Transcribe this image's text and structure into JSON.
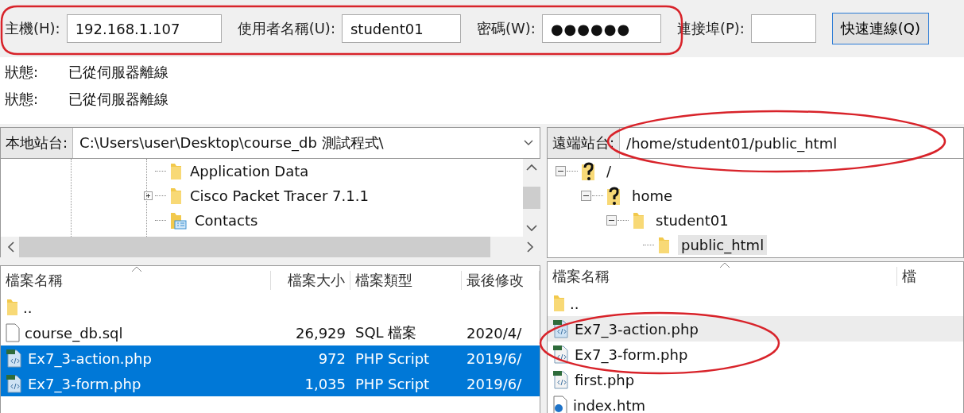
{
  "quickconnect": {
    "host_label": "主機(H):",
    "host": "192.168.1.107",
    "user_label": "使用者名稱(U):",
    "user": "student01",
    "password_label": "密碼(W):",
    "password": "●●●●●●",
    "port_label": "連接埠(P):",
    "connect_button": "快速連線(Q)"
  },
  "status_log": [
    {
      "label": "狀態:",
      "message": "已從伺服器離線"
    },
    {
      "label": "狀態:",
      "message": "已從伺服器離線"
    }
  ],
  "local_site": {
    "label": "本地站台:",
    "path": "C:\\Users\\user\\Desktop\\course_db 測試程式\\"
  },
  "local_tree": [
    {
      "name": "Application Data",
      "kind": "folder",
      "has_children": false
    },
    {
      "name": "Cisco Packet Tracer 7.1.1",
      "kind": "folder",
      "has_children": true
    },
    {
      "name": "Contacts",
      "kind": "contacts",
      "has_children": false
    }
  ],
  "remote_site": {
    "label": "遠端站台:",
    "path": "/home/student01/public_html"
  },
  "remote_tree": [
    {
      "name": "/",
      "kind": "unknown",
      "expanded": true,
      "selected": false,
      "children": [
        {
          "name": "home",
          "kind": "unknown",
          "expanded": true,
          "selected": false,
          "children": [
            {
              "name": "student01",
              "kind": "folder",
              "expanded": true,
              "selected": false,
              "children": [
                {
                  "name": "public_html",
                  "kind": "folder",
                  "selected": true
                }
              ]
            }
          ]
        }
      ]
    }
  ],
  "local_files": {
    "columns": [
      "檔案名稱",
      "檔案大小",
      "檔案類型",
      "最後修改"
    ],
    "rows": [
      {
        "name": "..",
        "kind": "folder",
        "size": "",
        "type": "",
        "modified": "",
        "selected": false
      },
      {
        "name": "course_db.sql",
        "kind": "file",
        "size": "26,929",
        "type": "SQL 檔案",
        "modified": "2020/4/",
        "selected": false
      },
      {
        "name": "Ex7_3-action.php",
        "kind": "php",
        "size": "972",
        "type": "PHP Script",
        "modified": "2019/6/",
        "selected": true
      },
      {
        "name": "Ex7_3-form.php",
        "kind": "php",
        "size": "1,035",
        "type": "PHP Script",
        "modified": "2019/6/",
        "selected": true
      }
    ]
  },
  "remote_files": {
    "columns": [
      "檔案名稱",
      "檔"
    ],
    "rows": [
      {
        "name": "..",
        "kind": "folder",
        "selected": false
      },
      {
        "name": "Ex7_3-action.php",
        "kind": "php",
        "selected": true
      },
      {
        "name": "Ex7_3-form.php",
        "kind": "php",
        "selected": false
      },
      {
        "name": "first.php",
        "kind": "php",
        "selected": false
      },
      {
        "name": "index.htm",
        "kind": "html",
        "selected": false
      }
    ]
  }
}
